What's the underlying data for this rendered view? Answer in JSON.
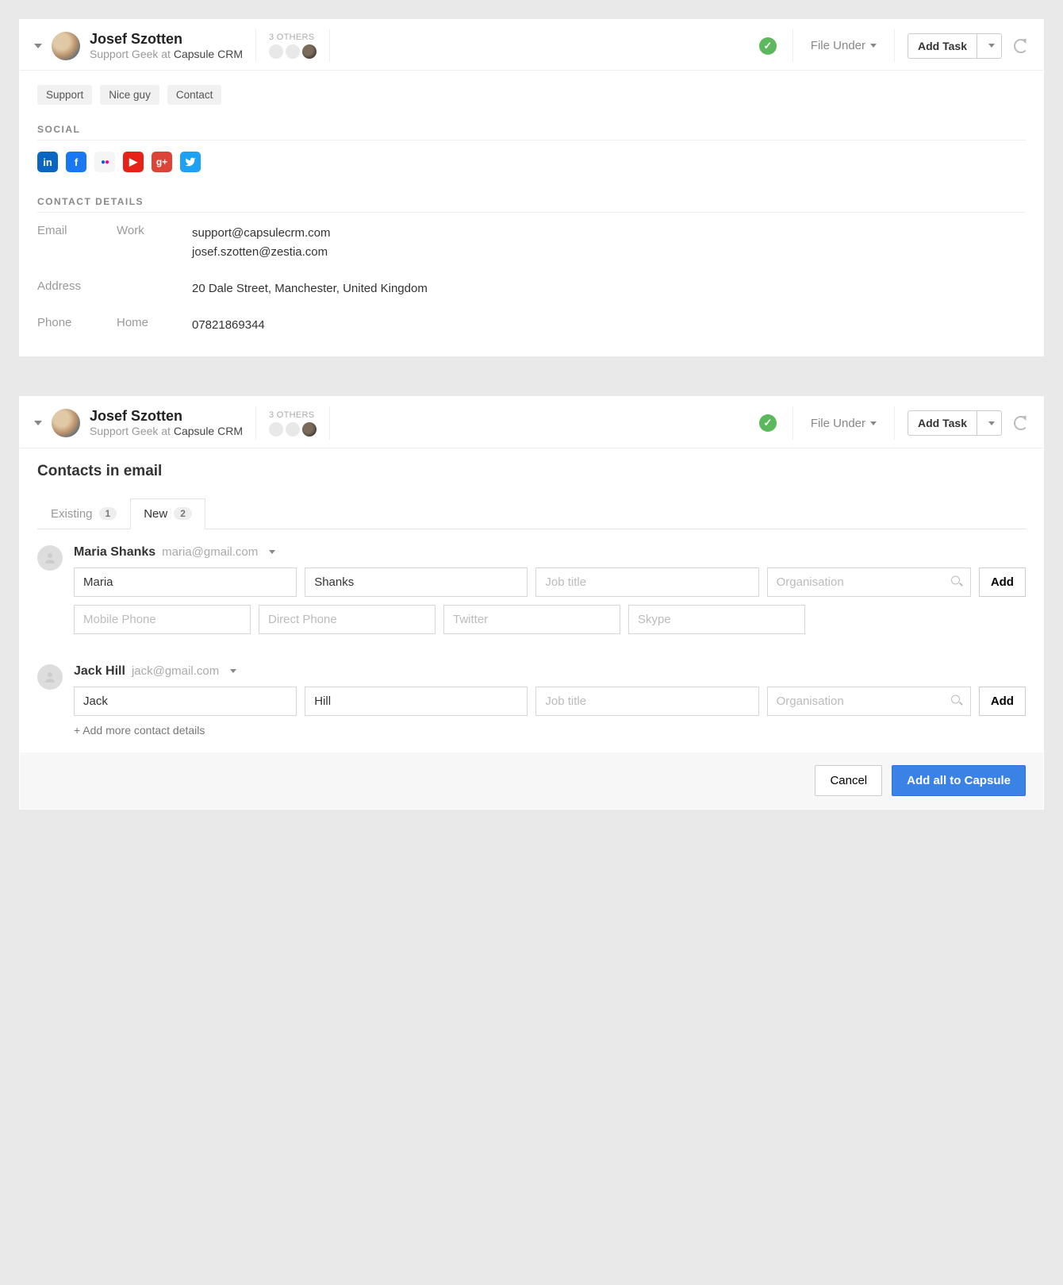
{
  "header": {
    "name": "Josef Szotten",
    "role": "Support Geek at",
    "org": "Capsule CRM",
    "others_label": "3 OTHERS",
    "file_under": "File Under",
    "add_task": "Add Task"
  },
  "tags": [
    "Support",
    "Nice guy",
    "Contact"
  ],
  "sections": {
    "social": "Social",
    "contact_details": "Contact Details"
  },
  "social_icons": [
    "linkedin-icon",
    "facebook-icon",
    "flickr-icon",
    "youtube-icon",
    "googleplus-icon",
    "twitter-icon"
  ],
  "details": {
    "email_label": "Email",
    "email_type": "Work",
    "emails": [
      "support@capsulecrm.com",
      "josef.szotten@zestia.com"
    ],
    "address_label": "Address",
    "address": "20 Dale Street, Manchester, United Kingdom",
    "phone_label": "Phone",
    "phone_type": "Home",
    "phone": "07821869344"
  },
  "contacts_section": {
    "title": "Contacts in email",
    "tabs": [
      {
        "label": "Existing",
        "count": "1",
        "active": false
      },
      {
        "label": "New",
        "count": "2",
        "active": true
      }
    ],
    "add_button": "Add",
    "add_more": "+ Add more contact details",
    "cancel": "Cancel",
    "add_all": "Add all to Capsule",
    "placeholders": {
      "job": "Job title",
      "org": "Organisation",
      "mobile": "Mobile Phone",
      "direct": "Direct Phone",
      "twitter": "Twitter",
      "skype": "Skype"
    },
    "contacts": [
      {
        "name": "Maria Shanks",
        "email": "maria@gmail.com",
        "first": "Maria",
        "last": "Shanks"
      },
      {
        "name": "Jack Hill",
        "email": "jack@gmail.com",
        "first": "Jack",
        "last": "Hill"
      }
    ]
  }
}
